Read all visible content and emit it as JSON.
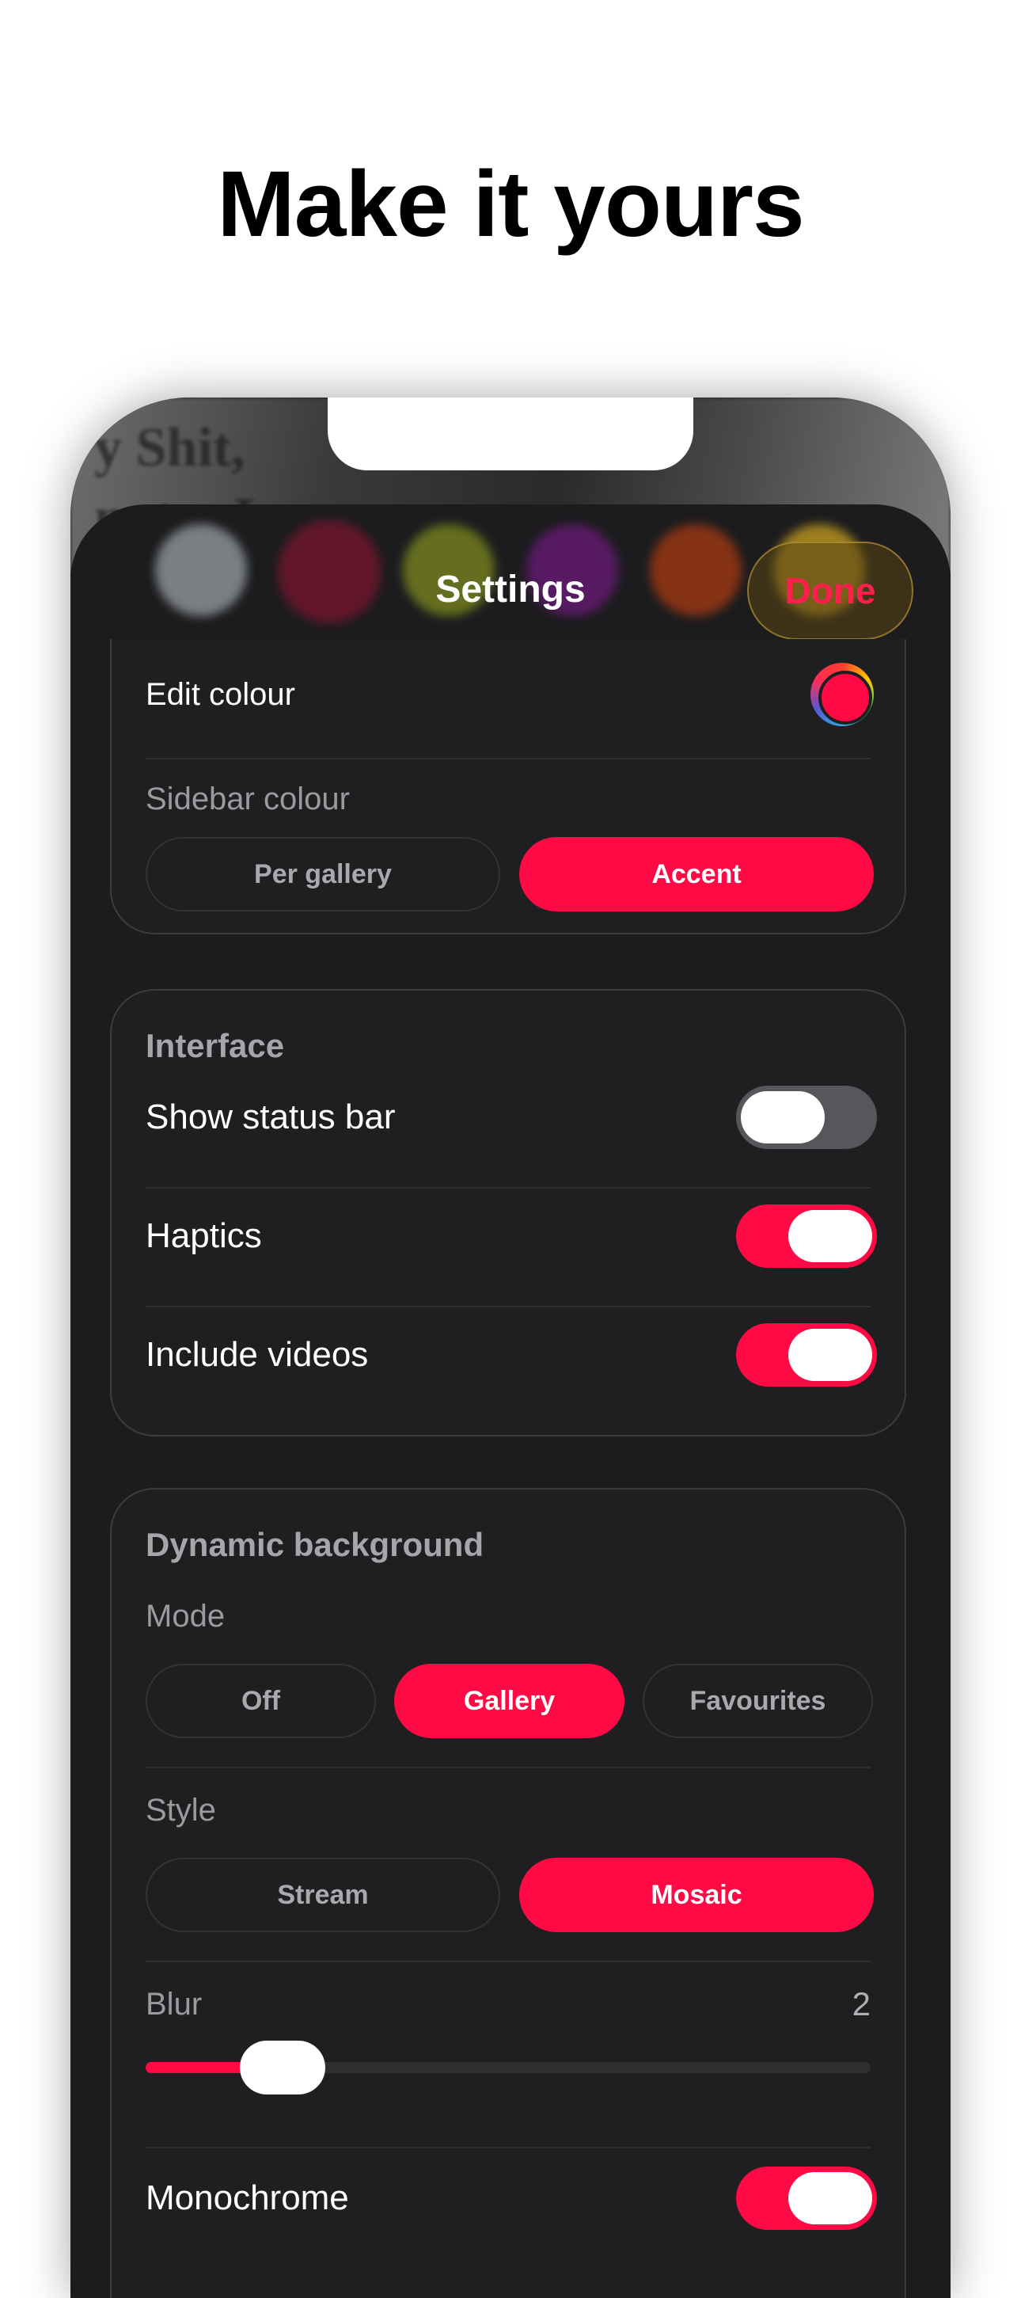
{
  "headline": "Make it yours",
  "wallpaper_text": "y Shit,\nnutes L",
  "header": {
    "title": "Settings",
    "done_label": "Done",
    "swatch_colors": [
      "#9aa0a6",
      "#7a1530",
      "#7d8a1f",
      "#6b1a7a",
      "#a83a12",
      "#c9a020"
    ]
  },
  "accent_color": "#ff0a45",
  "colour_card": {
    "edit_colour_label": "Edit colour",
    "sidebar_colour_label": "Sidebar colour",
    "sidebar_options": [
      "Per gallery",
      "Accent"
    ],
    "sidebar_selected": "Accent"
  },
  "interface_card": {
    "title": "Interface",
    "toggles": [
      {
        "label": "Show status bar",
        "on": false
      },
      {
        "label": "Haptics",
        "on": true
      },
      {
        "label": "Include videos",
        "on": true
      }
    ]
  },
  "dynamic_card": {
    "title": "Dynamic background",
    "mode_label": "Mode",
    "mode_options": [
      "Off",
      "Gallery",
      "Favourites"
    ],
    "mode_selected": "Gallery",
    "style_label": "Style",
    "style_options": [
      "Stream",
      "Mosaic"
    ],
    "style_selected": "Mosaic",
    "blur_label": "Blur",
    "blur_value": "2",
    "blur_fraction": 0.14,
    "monochrome_label": "Monochrome",
    "monochrome_on": true
  }
}
